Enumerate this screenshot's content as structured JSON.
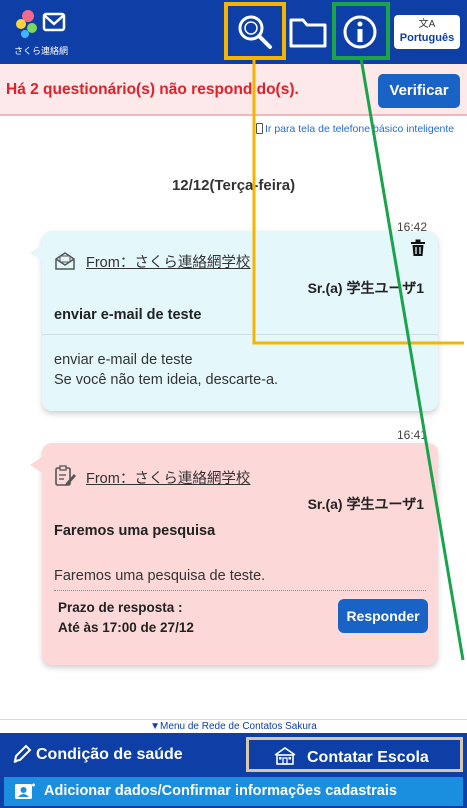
{
  "header": {
    "logo_text": "さくら連絡網",
    "search_label": "search",
    "folder_label": "folder",
    "info_label": "info",
    "language": {
      "glyph": "文A",
      "label": "Português"
    }
  },
  "notice": {
    "text": "Há 2 questionário(s) não respondido(s).",
    "button": "Verificar"
  },
  "switch_link": "Ir para tela de telefone básico inteligente",
  "date": "12/12(Terça-feira)",
  "messages": [
    {
      "time": "16:42",
      "icon": "envelope-icon",
      "from": "From：さくら連絡網学校",
      "recipient": "Sr.(a) 学生ユーザ1",
      "subject": "enviar e-mail de teste",
      "body": [
        "enviar e-mail de teste",
        "Se você não tem ideia, descarte-a."
      ]
    },
    {
      "time": "16:41",
      "icon": "clipboard-edit-icon",
      "from": "From：さくら連絡網学校",
      "recipient": "Sr.(a) 学生ユーザ1",
      "subject": "Faremos uma pesquisa",
      "body": [
        "Faremos uma pesquisa de teste."
      ],
      "deadline_label": "Prazo de resposta :",
      "deadline_value": "Até às 17:00 de 27/12",
      "button": "Responder"
    }
  ],
  "footer": {
    "menu_link": "▼Menu de Rede de Contatos Sakura",
    "health_button": "Condição de saúde",
    "contact_button": "Contatar Escola",
    "register_button": "Adicionar dados/Confirmar informações cadastrais"
  },
  "colors": {
    "header": "#0d3fa6",
    "notice_text": "#e0202a",
    "mail_card": "#e4f7fb",
    "survey_card": "#fcd8d8",
    "button": "#1a63c6",
    "highlight_yellow": "#f4b400",
    "highlight_green": "#1aa34a"
  }
}
